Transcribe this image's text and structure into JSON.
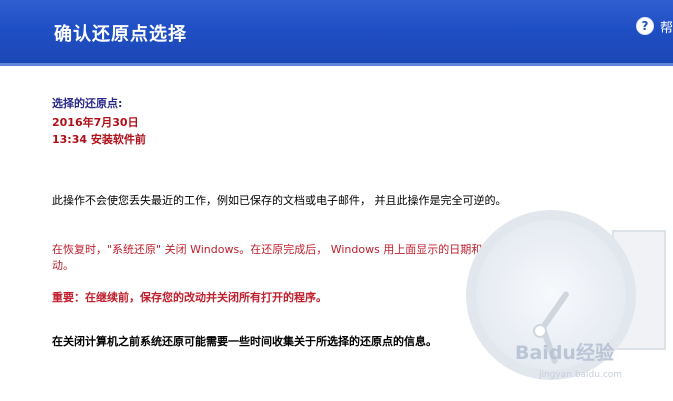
{
  "header": {
    "title": "确认还原点选择",
    "help_label": "帮"
  },
  "restore_point": {
    "label": "选择的还原点:",
    "date": "2016年7月30日",
    "time_desc": "13:34 安装软件前"
  },
  "messages": {
    "info": "此操作不会使您丢失最近的工作，例如已保存的文档或电子邮件， 并且此操作是完全可逆的。",
    "restart": "在恢复时，\"系统还原\" 关闭 Windows。在还原完成后， Windows 用上面显示的日期和时间的设置重启动。",
    "important": "重要：在继续前，保存您的改动并关闭所有打开的程序。",
    "collect": "在关闭计算机之前系统还原可能需要一些时间收集关于所选择的还原点的信息。"
  },
  "watermark": {
    "text": "Baidu经验",
    "sub": "jingyan.baidu.com"
  }
}
